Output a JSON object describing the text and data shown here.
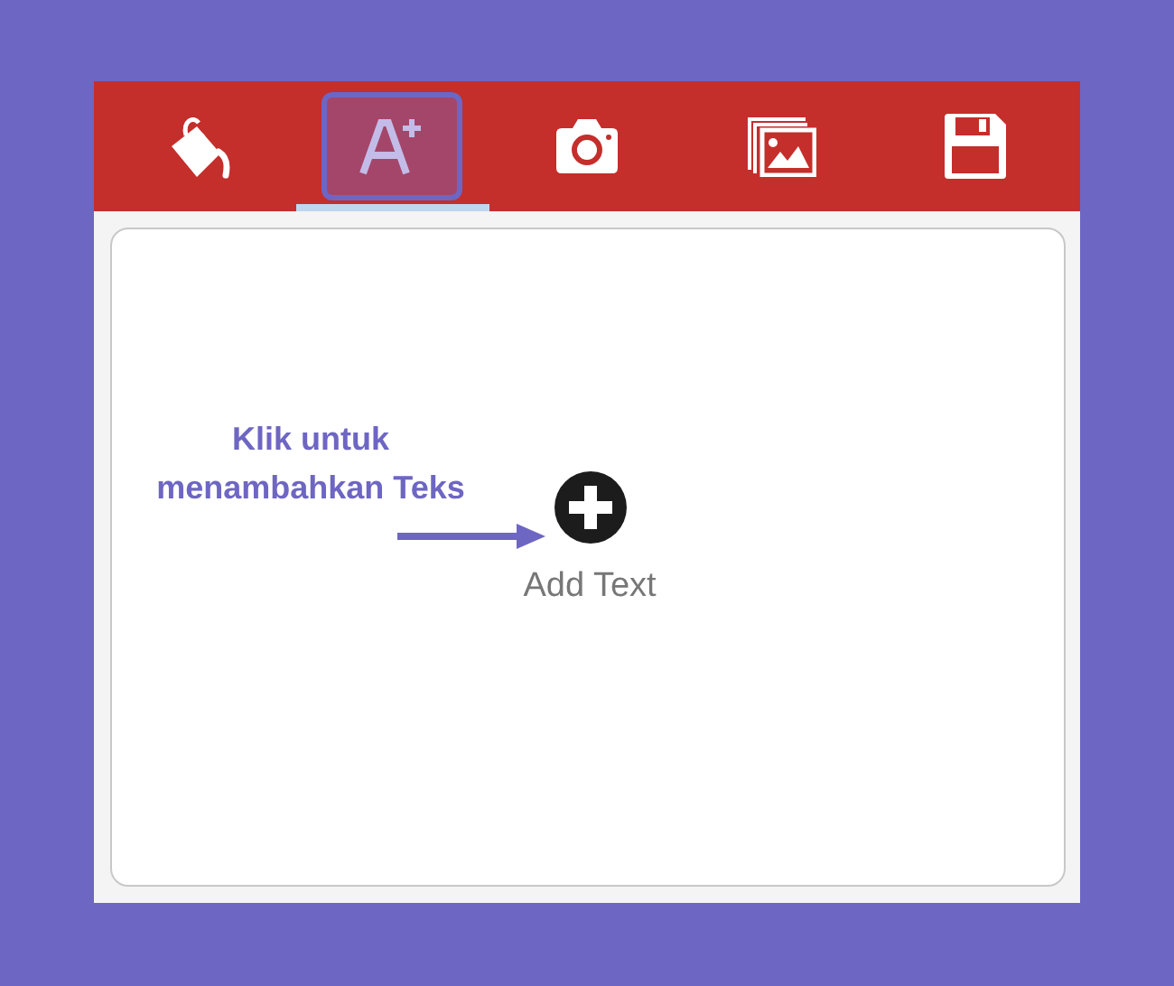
{
  "toolbar": {
    "tabs": [
      {
        "kind": "paint",
        "selected": false
      },
      {
        "kind": "text",
        "selected": true
      },
      {
        "kind": "camera",
        "selected": false
      },
      {
        "kind": "gallery",
        "selected": false
      },
      {
        "kind": "save",
        "selected": false
      }
    ]
  },
  "canvas": {
    "add_label": "Add Text"
  },
  "annotation": {
    "text": "Klik untuk menambahkan Teks"
  }
}
